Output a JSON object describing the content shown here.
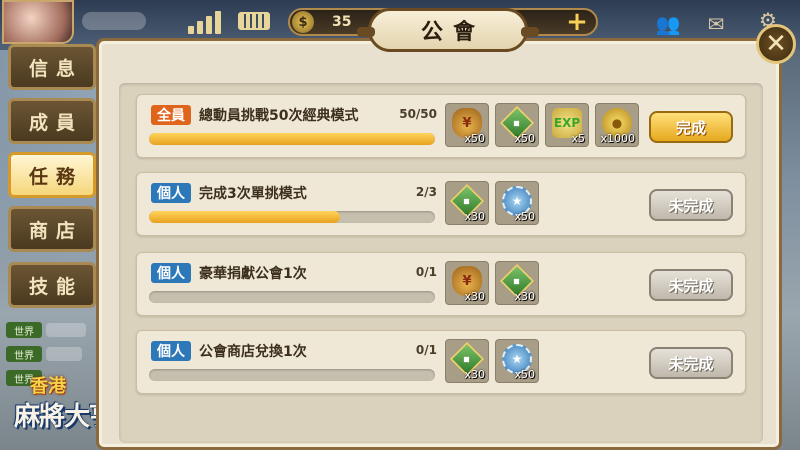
{
  "topbar": {
    "coin_value": "35",
    "coin_symbol": "$",
    "plus_label": "+"
  },
  "dialog": {
    "title": "公會",
    "close_label": "✕"
  },
  "tabs": [
    {
      "label": "信息",
      "active": false
    },
    {
      "label": "成員",
      "active": false
    },
    {
      "label": "任務",
      "active": true
    },
    {
      "label": "商店",
      "active": false
    },
    {
      "label": "技能",
      "active": false
    }
  ],
  "chat": {
    "tags": [
      "世界",
      "世界",
      "世界"
    ]
  },
  "logo": {
    "small": "香港",
    "main": "麻將大亨"
  },
  "tasks": [
    {
      "badge": "全員",
      "badge_type": "all",
      "name": "總動員挑戰50次經典模式",
      "progress_text": "50/50",
      "progress_fraction": 1.0,
      "rewards": [
        {
          "icon": "money-bag-icon",
          "count": "x50"
        },
        {
          "icon": "mahjong-tile-icon",
          "count": "x50"
        },
        {
          "icon": "exp-icon",
          "count": "x5"
        },
        {
          "icon": "gold-coin-icon",
          "count": "x1000"
        }
      ],
      "status": "完成",
      "status_type": "done"
    },
    {
      "badge": "個人",
      "badge_type": "solo",
      "name": "完成3次單挑模式",
      "progress_text": "2/3",
      "progress_fraction": 0.667,
      "rewards": [
        {
          "icon": "mahjong-tile-icon",
          "count": "x30"
        },
        {
          "icon": "medal-icon",
          "count": "x50"
        }
      ],
      "status": "未完成",
      "status_type": "todo"
    },
    {
      "badge": "個人",
      "badge_type": "solo",
      "name": "豪華捐獻公會1次",
      "progress_text": "0/1",
      "progress_fraction": 0.0,
      "rewards": [
        {
          "icon": "money-bag-icon",
          "count": "x30"
        },
        {
          "icon": "mahjong-tile-icon",
          "count": "x30"
        }
      ],
      "status": "未完成",
      "status_type": "todo"
    },
    {
      "badge": "個人",
      "badge_type": "solo",
      "name": "公會商店兌換1次",
      "progress_text": "0/1",
      "progress_fraction": 0.0,
      "rewards": [
        {
          "icon": "mahjong-tile-icon",
          "count": "x30"
        },
        {
          "icon": "medal-icon",
          "count": "x50"
        }
      ],
      "status": "未完成",
      "status_type": "todo"
    }
  ],
  "icon_glyphs": {
    "money-bag-icon": "¥",
    "mahjong-tile-icon": "◆",
    "exp-icon": "EXP",
    "gold-coin-icon": "●",
    "medal-icon": "★"
  },
  "colors": {
    "badge_all": "#e0651c",
    "badge_solo": "#2d78b9",
    "progress_fill": "#f0b52c",
    "done_button": "#f2c242",
    "todo_button": "#cfc9be"
  }
}
